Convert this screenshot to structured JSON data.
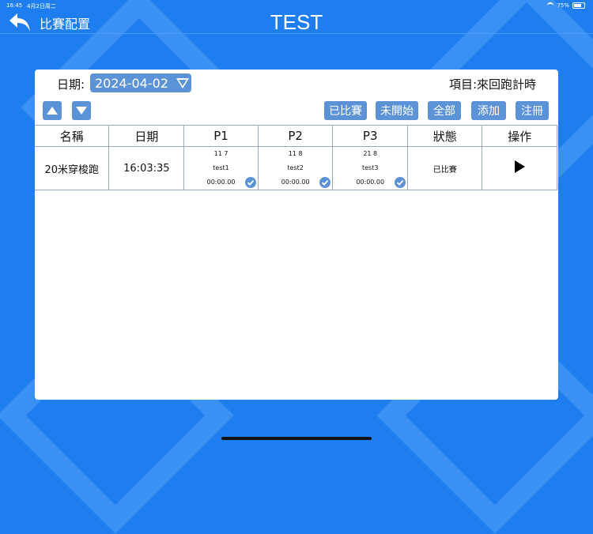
{
  "status_bar": {
    "time": "16:45",
    "date": "4月2日周二",
    "battery": "75%"
  },
  "nav": {
    "back_label": "比賽配置",
    "title": "TEST"
  },
  "filters": {
    "date_label": "日期:",
    "date_value": "2024-04-02",
    "project": "項目:來回跑計時"
  },
  "buttons": {
    "completed": "已比賽",
    "not_started": "未開始",
    "all": "全部",
    "add": "添加",
    "register": "注冊"
  },
  "table": {
    "headers": [
      "名稱",
      "日期",
      "P1",
      "P2",
      "P3",
      "狀態",
      "操作"
    ],
    "rows": [
      {
        "name": "20米穿梭跑",
        "time": "16:03:35",
        "p1": {
          "code": "11 7",
          "player": "test1",
          "result": "00:00.00"
        },
        "p2": {
          "code": "11 8",
          "player": "test2",
          "result": "00:00.00"
        },
        "p3": {
          "code": "21 8",
          "player": "test3",
          "result": "00:00.00"
        },
        "status": "已比賽"
      }
    ]
  },
  "icons": {
    "back": "back-arrow-icon",
    "check": "check-circle-icon",
    "play": "play-icon",
    "up": "triangle-up-icon",
    "down": "triangle-down-icon"
  },
  "colors": {
    "background": "#1e7ef0",
    "button": "#5c93d6",
    "card": "#ffffff"
  }
}
